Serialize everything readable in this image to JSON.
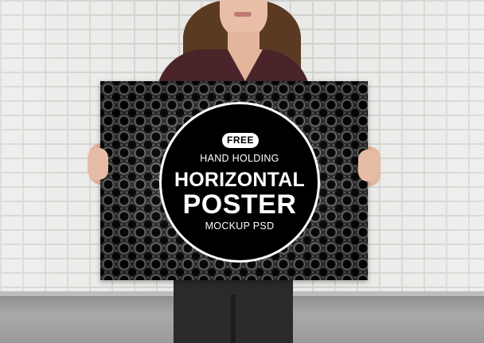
{
  "poster": {
    "badge": "FREE",
    "line1": "HAND HOLDING",
    "line2": "HORIZONTAL",
    "line3": "POSTER",
    "line4": "MOCKUP PSD"
  },
  "colors": {
    "wall": "#e9e9e7",
    "floor": "#a0a0a0",
    "poster_bg": "#181818",
    "badge_circle": "#000000",
    "text": "#ffffff",
    "shirt": "#4a2429"
  }
}
